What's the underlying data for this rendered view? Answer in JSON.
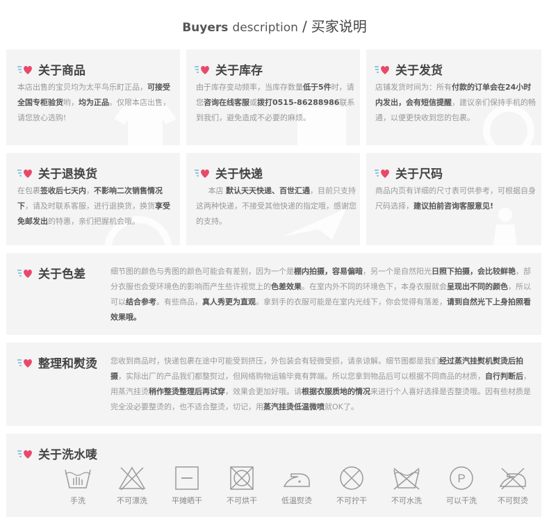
{
  "header": {
    "bold": "Buyers",
    "normal": "description",
    "slash": "/",
    "cn": "买家说明"
  },
  "cards": {
    "product": {
      "title": "关于商品"
    },
    "stock": {
      "title": "关于库存"
    },
    "shipping": {
      "title": "关于发货"
    },
    "returns": {
      "title": "关于退换货"
    },
    "express": {
      "title": "关于快递"
    },
    "size": {
      "title": "关于尺码"
    },
    "color": {
      "title": "关于色差"
    },
    "ironing": {
      "title": "整理和熨烫"
    },
    "washing": {
      "title": "关于洗水唛"
    }
  },
  "wash_labels": [
    "手洗",
    "不可漂洗",
    "平摊晒干",
    "不可烘干",
    "低温熨烫",
    "不可拧干",
    "不可水洗",
    "可以干洗",
    "不可熨烫"
  ],
  "icons": {
    "heart": "heart-icon",
    "wash": [
      "hand-wash-icon",
      "no-bleach-icon",
      "dry-flat-icon",
      "no-tumble-dry-icon",
      "low-iron-icon",
      "no-wring-icon",
      "no-wash-icon",
      "dry-clean-icon",
      "no-iron-icon"
    ]
  },
  "colors": {
    "accent": "#e8496a",
    "sparkle": "#6db8d6",
    "card_bg": "#f4f4f4"
  }
}
